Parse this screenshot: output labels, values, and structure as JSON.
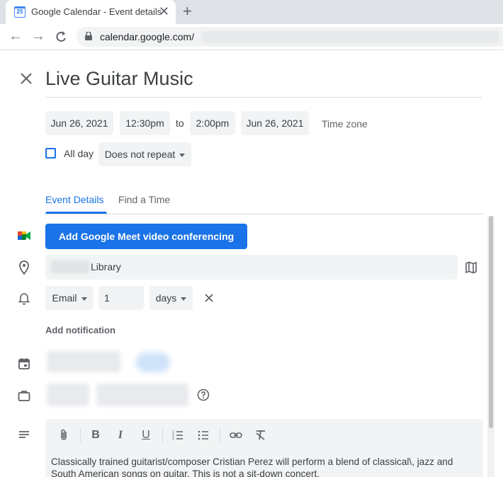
{
  "browser": {
    "favicon_text": "25",
    "tab_title": "Google Calendar - Event details",
    "url": "calendar.google.com/"
  },
  "event": {
    "title": "Live Guitar Music",
    "start_date": "Jun 26, 2021",
    "start_time": "12:30pm",
    "to_label": "to",
    "end_time": "2:00pm",
    "end_date": "Jun 26, 2021",
    "time_zone_label": "Time zone",
    "all_day_label": "All day",
    "all_day_checked": false,
    "repeat": "Does not repeat"
  },
  "tabs": {
    "event_details": "Event Details",
    "find_a_time": "Find a Time"
  },
  "meet_button": "Add Google Meet video conferencing",
  "location": "Library",
  "notification": {
    "method": "Email",
    "amount": "1",
    "unit": "days",
    "add_label": "Add notification"
  },
  "description": "Classically trained guitarist/composer Cristian Perez will perform a blend of classical\\, jazz and South American songs on guitar. This is not a sit-down concert.",
  "colors": {
    "accent": "#1a73e8",
    "chip_bg": "#f1f3f4",
    "meet_green": "#00832d",
    "meet_yellow": "#ffba00"
  }
}
